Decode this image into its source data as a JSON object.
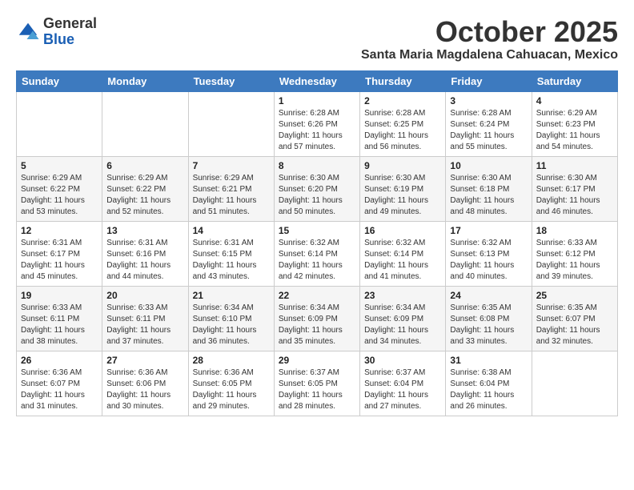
{
  "logo": {
    "general": "General",
    "blue": "Blue"
  },
  "title": "October 2025",
  "location": "Santa Maria Magdalena Cahuacan, Mexico",
  "weekdays": [
    "Sunday",
    "Monday",
    "Tuesday",
    "Wednesday",
    "Thursday",
    "Friday",
    "Saturday"
  ],
  "weeks": [
    [
      {
        "day": "",
        "info": ""
      },
      {
        "day": "",
        "info": ""
      },
      {
        "day": "",
        "info": ""
      },
      {
        "day": "1",
        "info": "Sunrise: 6:28 AM\nSunset: 6:26 PM\nDaylight: 11 hours\nand 57 minutes."
      },
      {
        "day": "2",
        "info": "Sunrise: 6:28 AM\nSunset: 6:25 PM\nDaylight: 11 hours\nand 56 minutes."
      },
      {
        "day": "3",
        "info": "Sunrise: 6:28 AM\nSunset: 6:24 PM\nDaylight: 11 hours\nand 55 minutes."
      },
      {
        "day": "4",
        "info": "Sunrise: 6:29 AM\nSunset: 6:23 PM\nDaylight: 11 hours\nand 54 minutes."
      }
    ],
    [
      {
        "day": "5",
        "info": "Sunrise: 6:29 AM\nSunset: 6:22 PM\nDaylight: 11 hours\nand 53 minutes."
      },
      {
        "day": "6",
        "info": "Sunrise: 6:29 AM\nSunset: 6:22 PM\nDaylight: 11 hours\nand 52 minutes."
      },
      {
        "day": "7",
        "info": "Sunrise: 6:29 AM\nSunset: 6:21 PM\nDaylight: 11 hours\nand 51 minutes."
      },
      {
        "day": "8",
        "info": "Sunrise: 6:30 AM\nSunset: 6:20 PM\nDaylight: 11 hours\nand 50 minutes."
      },
      {
        "day": "9",
        "info": "Sunrise: 6:30 AM\nSunset: 6:19 PM\nDaylight: 11 hours\nand 49 minutes."
      },
      {
        "day": "10",
        "info": "Sunrise: 6:30 AM\nSunset: 6:18 PM\nDaylight: 11 hours\nand 48 minutes."
      },
      {
        "day": "11",
        "info": "Sunrise: 6:30 AM\nSunset: 6:17 PM\nDaylight: 11 hours\nand 46 minutes."
      }
    ],
    [
      {
        "day": "12",
        "info": "Sunrise: 6:31 AM\nSunset: 6:17 PM\nDaylight: 11 hours\nand 45 minutes."
      },
      {
        "day": "13",
        "info": "Sunrise: 6:31 AM\nSunset: 6:16 PM\nDaylight: 11 hours\nand 44 minutes."
      },
      {
        "day": "14",
        "info": "Sunrise: 6:31 AM\nSunset: 6:15 PM\nDaylight: 11 hours\nand 43 minutes."
      },
      {
        "day": "15",
        "info": "Sunrise: 6:32 AM\nSunset: 6:14 PM\nDaylight: 11 hours\nand 42 minutes."
      },
      {
        "day": "16",
        "info": "Sunrise: 6:32 AM\nSunset: 6:14 PM\nDaylight: 11 hours\nand 41 minutes."
      },
      {
        "day": "17",
        "info": "Sunrise: 6:32 AM\nSunset: 6:13 PM\nDaylight: 11 hours\nand 40 minutes."
      },
      {
        "day": "18",
        "info": "Sunrise: 6:33 AM\nSunset: 6:12 PM\nDaylight: 11 hours\nand 39 minutes."
      }
    ],
    [
      {
        "day": "19",
        "info": "Sunrise: 6:33 AM\nSunset: 6:11 PM\nDaylight: 11 hours\nand 38 minutes."
      },
      {
        "day": "20",
        "info": "Sunrise: 6:33 AM\nSunset: 6:11 PM\nDaylight: 11 hours\nand 37 minutes."
      },
      {
        "day": "21",
        "info": "Sunrise: 6:34 AM\nSunset: 6:10 PM\nDaylight: 11 hours\nand 36 minutes."
      },
      {
        "day": "22",
        "info": "Sunrise: 6:34 AM\nSunset: 6:09 PM\nDaylight: 11 hours\nand 35 minutes."
      },
      {
        "day": "23",
        "info": "Sunrise: 6:34 AM\nSunset: 6:09 PM\nDaylight: 11 hours\nand 34 minutes."
      },
      {
        "day": "24",
        "info": "Sunrise: 6:35 AM\nSunset: 6:08 PM\nDaylight: 11 hours\nand 33 minutes."
      },
      {
        "day": "25",
        "info": "Sunrise: 6:35 AM\nSunset: 6:07 PM\nDaylight: 11 hours\nand 32 minutes."
      }
    ],
    [
      {
        "day": "26",
        "info": "Sunrise: 6:36 AM\nSunset: 6:07 PM\nDaylight: 11 hours\nand 31 minutes."
      },
      {
        "day": "27",
        "info": "Sunrise: 6:36 AM\nSunset: 6:06 PM\nDaylight: 11 hours\nand 30 minutes."
      },
      {
        "day": "28",
        "info": "Sunrise: 6:36 AM\nSunset: 6:05 PM\nDaylight: 11 hours\nand 29 minutes."
      },
      {
        "day": "29",
        "info": "Sunrise: 6:37 AM\nSunset: 6:05 PM\nDaylight: 11 hours\nand 28 minutes."
      },
      {
        "day": "30",
        "info": "Sunrise: 6:37 AM\nSunset: 6:04 PM\nDaylight: 11 hours\nand 27 minutes."
      },
      {
        "day": "31",
        "info": "Sunrise: 6:38 AM\nSunset: 6:04 PM\nDaylight: 11 hours\nand 26 minutes."
      },
      {
        "day": "",
        "info": ""
      }
    ]
  ]
}
